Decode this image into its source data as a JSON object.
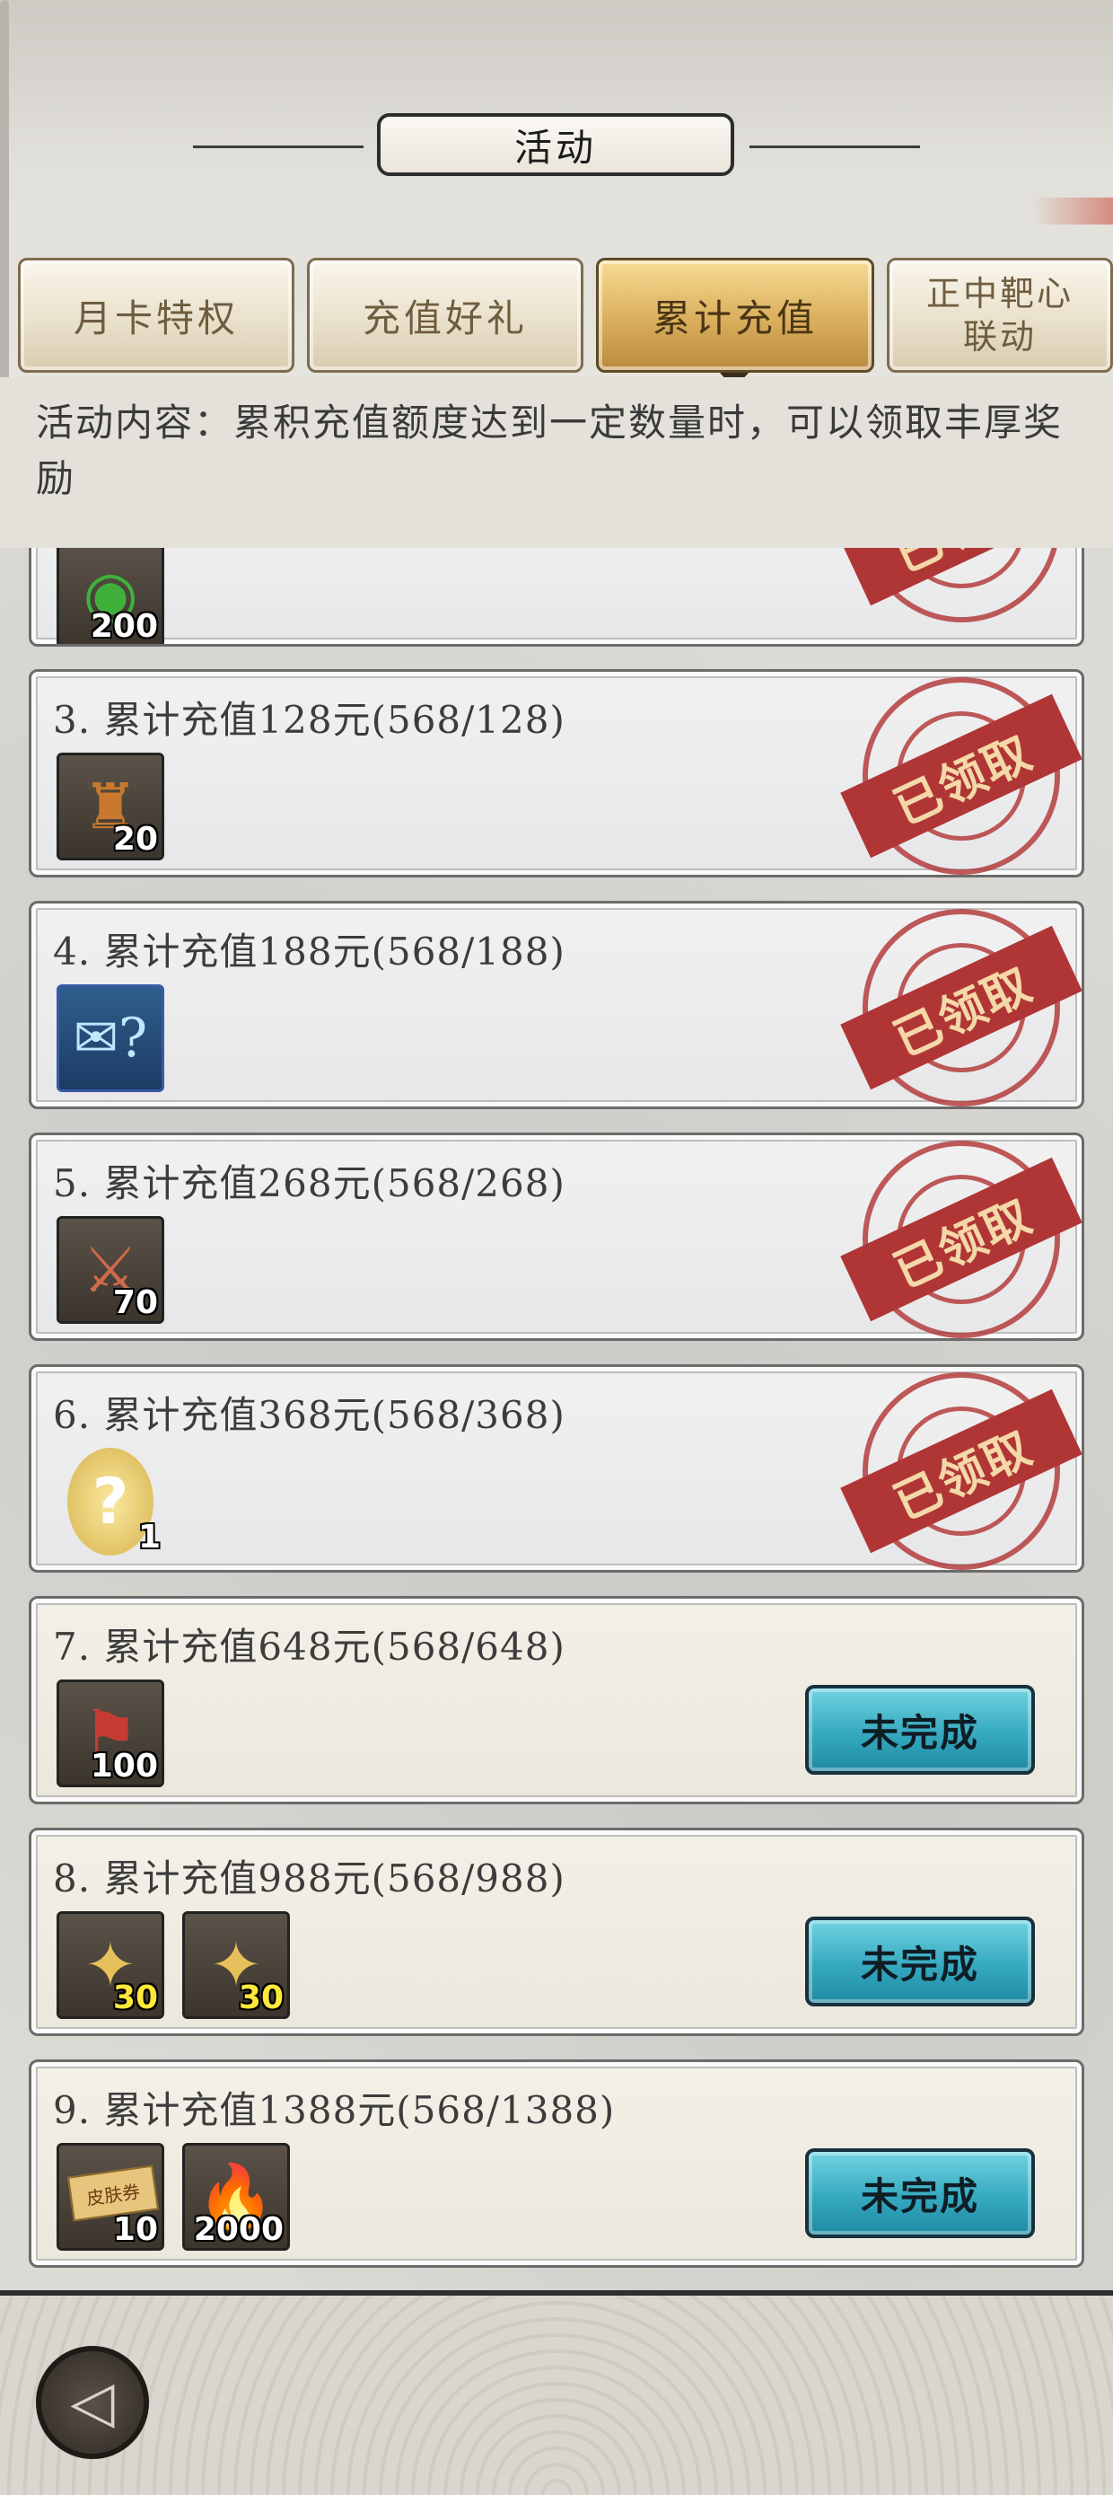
{
  "header": {
    "title": "活动"
  },
  "tabs": [
    {
      "label": "月卡特权"
    },
    {
      "label": "充值好礼"
    },
    {
      "label": "累计充值"
    },
    {
      "label_line1": "正中靶心",
      "label_line2": "联动"
    }
  ],
  "description": "活动内容：累积充值额度达到一定数量时，可以领取丰厚奖励",
  "claimed_stamp": "已领取",
  "rows": [
    {
      "items": [
        {
          "icon": "jade-coin-icon",
          "qty": "200"
        }
      ]
    },
    {
      "title": "3.  累计充值128元(568/128)",
      "items": [
        {
          "icon": "token-bag-icon",
          "qty": "20"
        }
      ]
    },
    {
      "title": "4.  累计充值188元(568/188)",
      "items": [
        {
          "icon": "mystery-scroll-icon",
          "qty": ""
        }
      ]
    },
    {
      "title": "5.  累计充值268元(568/268)",
      "items": [
        {
          "icon": "crossed-swords-medal-icon",
          "qty": "70"
        }
      ]
    },
    {
      "title": "6.  累计充值368元(568/368)",
      "items": [
        {
          "icon": "mystery-egg-icon",
          "qty": "1"
        }
      ]
    },
    {
      "title": "7.  累计充值648元(568/648)",
      "button": "未完成",
      "items": [
        {
          "icon": "banner-icon",
          "qty": "100"
        }
      ]
    },
    {
      "title": "8.  累计充值988元(568/988)",
      "button": "未完成",
      "items": [
        {
          "icon": "puzzle-piece-icon",
          "qty": "30"
        },
        {
          "icon": "puzzle-piece-icon",
          "qty": "30"
        }
      ]
    },
    {
      "title": "9.  累计充值1388元(568/1388)",
      "button": "未完成",
      "items": [
        {
          "icon": "skin-ticket-icon",
          "qty": "10",
          "label": "皮肤券"
        },
        {
          "icon": "blue-flame-icon",
          "qty": "2000"
        }
      ]
    }
  ],
  "colors": {
    "stamp": "#b03636",
    "button": "#35a9c0",
    "active_tab": "#d9ae5c"
  }
}
